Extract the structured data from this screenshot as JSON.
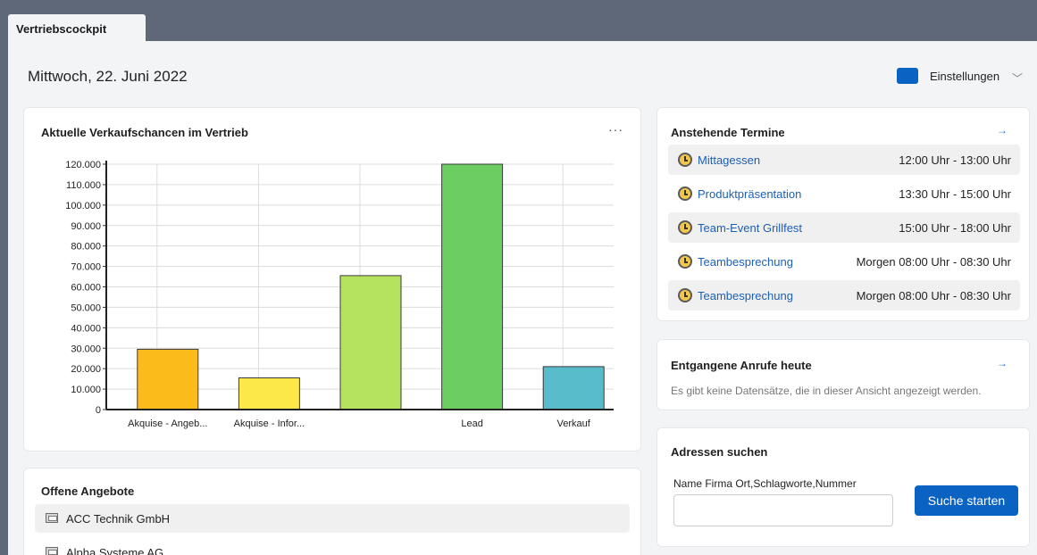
{
  "tab": {
    "label": "Vertriebscockpit"
  },
  "header": {
    "date": "Mittwoch, 22. Juni 2022",
    "settings_label": "Einstellungen",
    "accent": "#0a62c2"
  },
  "chart_card": {
    "title": "Aktuelle Verkaufschancen im Vertrieb",
    "more": "···"
  },
  "chart_data": {
    "type": "bar",
    "categories": [
      "Akquise - Angeb...",
      "Akquise - Infor...",
      "",
      "Lead",
      "Verkauf"
    ],
    "values": [
      29500,
      15500,
      65500,
      120000,
      21000
    ],
    "colors": [
      "#fbbc1b",
      "#fde84a",
      "#b6e35d",
      "#6ccd62",
      "#58bccb"
    ],
    "ylim": [
      0,
      120000
    ],
    "yticks": [
      "0",
      "10.000",
      "20.000",
      "30.000",
      "40.000",
      "50.000",
      "60.000",
      "70.000",
      "80.000",
      "90.000",
      "100.000",
      "110.000",
      "120.000"
    ],
    "grid": true
  },
  "offers": {
    "title": "Offene Angebote",
    "items": [
      {
        "label": "ACC Technik GmbH"
      },
      {
        "label": "Alpha Systeme AG"
      }
    ]
  },
  "appointments": {
    "title": "Anstehende Termine",
    "link_icon": "→",
    "items": [
      {
        "name": "Mittagessen",
        "time": "12:00 Uhr - 13:00 Uhr"
      },
      {
        "name": "Produktpräsentation",
        "time": "13:30 Uhr - 15:00 Uhr"
      },
      {
        "name": "Team-Event Grillfest",
        "time": "15:00 Uhr - 18:00 Uhr"
      },
      {
        "name": "Teambesprechung",
        "time": "Morgen 08:00 Uhr - 08:30 Uhr"
      },
      {
        "name": "Teambesprechung",
        "time": "Morgen 08:00 Uhr - 08:30 Uhr"
      }
    ]
  },
  "missed_calls": {
    "title": "Entgangene Anrufe heute",
    "link_icon": "→",
    "empty": "Es gibt keine Datensätze, die in dieser Ansicht angezeigt werden."
  },
  "address_search": {
    "title": "Adressen suchen",
    "label": "Name Firma Ort,Schlagworte,Nummer",
    "value": "",
    "button": "Suche starten"
  }
}
